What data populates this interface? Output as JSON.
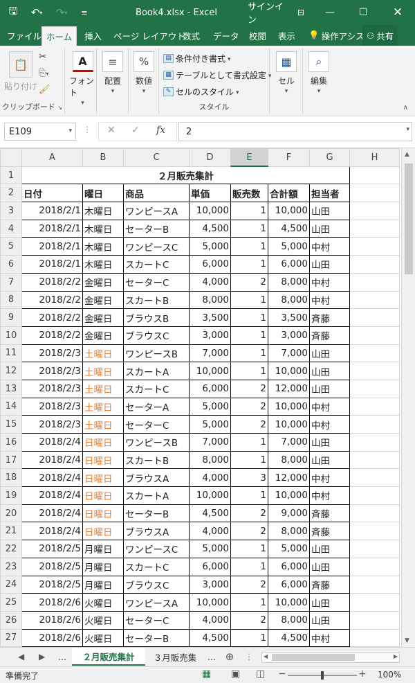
{
  "titlebar": {
    "title": "Book4.xlsx  -  Excel",
    "signin": "サインイン",
    "save_icon": "save-icon",
    "undo_icon": "undo-icon",
    "redo_icon": "redo-icon"
  },
  "tabs": [
    "ファイル",
    "ホーム",
    "挿入",
    "ページ レイアウト",
    "数式",
    "データ",
    "校閲",
    "表示"
  ],
  "tell_me": "操作アシス",
  "share": "共有",
  "ribbon": {
    "paste": "貼り付け",
    "clipboard": "クリップボード",
    "font": "フォント",
    "alignment": "配置",
    "number": "数値",
    "cond_format": "条件付き書式",
    "table_format": "テーブルとして書式設定",
    "cell_style": "セルのスタイル",
    "styles": "スタイル",
    "cells": "セル",
    "editing": "編集"
  },
  "formula_bar": {
    "name_box": "E109",
    "value": "2"
  },
  "columns": [
    "A",
    "B",
    "C",
    "D",
    "E",
    "F",
    "G",
    "H"
  ],
  "selected_column": "E",
  "sheet": {
    "title": "２月販売集計",
    "headers": [
      "日付",
      "曜日",
      "商品",
      "単価",
      "販売数",
      "合計額",
      "担当者"
    ],
    "rows": [
      {
        "n": "3",
        "date": "2018/2/1",
        "day": "木曜日",
        "item": "ワンピースA",
        "price": "10,000",
        "qty": "1",
        "total": "10,000",
        "rep": "山田",
        "wk": false
      },
      {
        "n": "4",
        "date": "2018/2/1",
        "day": "木曜日",
        "item": "セーターB",
        "price": "4,500",
        "qty": "1",
        "total": "4,500",
        "rep": "山田",
        "wk": false
      },
      {
        "n": "5",
        "date": "2018/2/1",
        "day": "木曜日",
        "item": "ワンピースC",
        "price": "5,000",
        "qty": "1",
        "total": "5,000",
        "rep": "中村",
        "wk": false
      },
      {
        "n": "6",
        "date": "2018/2/1",
        "day": "木曜日",
        "item": "スカートC",
        "price": "6,000",
        "qty": "1",
        "total": "6,000",
        "rep": "山田",
        "wk": false
      },
      {
        "n": "7",
        "date": "2018/2/2",
        "day": "金曜日",
        "item": "セーターC",
        "price": "4,000",
        "qty": "2",
        "total": "8,000",
        "rep": "中村",
        "wk": false
      },
      {
        "n": "8",
        "date": "2018/2/2",
        "day": "金曜日",
        "item": "スカートB",
        "price": "8,000",
        "qty": "1",
        "total": "8,000",
        "rep": "中村",
        "wk": false
      },
      {
        "n": "9",
        "date": "2018/2/2",
        "day": "金曜日",
        "item": "ブラウスB",
        "price": "3,500",
        "qty": "1",
        "total": "3,500",
        "rep": "斉藤",
        "wk": false
      },
      {
        "n": "10",
        "date": "2018/2/2",
        "day": "金曜日",
        "item": "ブラウスC",
        "price": "3,000",
        "qty": "1",
        "total": "3,000",
        "rep": "斉藤",
        "wk": false
      },
      {
        "n": "11",
        "date": "2018/2/3",
        "day": "土曜日",
        "item": "ワンピースB",
        "price": "7,000",
        "qty": "1",
        "total": "7,000",
        "rep": "山田",
        "wk": true
      },
      {
        "n": "12",
        "date": "2018/2/3",
        "day": "土曜日",
        "item": "スカートA",
        "price": "10,000",
        "qty": "1",
        "total": "10,000",
        "rep": "山田",
        "wk": true
      },
      {
        "n": "13",
        "date": "2018/2/3",
        "day": "土曜日",
        "item": "スカートC",
        "price": "6,000",
        "qty": "2",
        "total": "12,000",
        "rep": "山田",
        "wk": true
      },
      {
        "n": "14",
        "date": "2018/2/3",
        "day": "土曜日",
        "item": "セーターA",
        "price": "5,000",
        "qty": "2",
        "total": "10,000",
        "rep": "中村",
        "wk": true
      },
      {
        "n": "15",
        "date": "2018/2/3",
        "day": "土曜日",
        "item": "セーターC",
        "price": "5,000",
        "qty": "2",
        "total": "10,000",
        "rep": "中村",
        "wk": true
      },
      {
        "n": "16",
        "date": "2018/2/4",
        "day": "日曜日",
        "item": "ワンピースB",
        "price": "7,000",
        "qty": "1",
        "total": "7,000",
        "rep": "山田",
        "wk": true
      },
      {
        "n": "17",
        "date": "2018/2/4",
        "day": "日曜日",
        "item": "スカートB",
        "price": "8,000",
        "qty": "1",
        "total": "8,000",
        "rep": "山田",
        "wk": true
      },
      {
        "n": "18",
        "date": "2018/2/4",
        "day": "日曜日",
        "item": "ブラウスA",
        "price": "4,000",
        "qty": "3",
        "total": "12,000",
        "rep": "中村",
        "wk": true
      },
      {
        "n": "19",
        "date": "2018/2/4",
        "day": "日曜日",
        "item": "スカートA",
        "price": "10,000",
        "qty": "1",
        "total": "10,000",
        "rep": "中村",
        "wk": true
      },
      {
        "n": "20",
        "date": "2018/2/4",
        "day": "日曜日",
        "item": "セーターB",
        "price": "4,500",
        "qty": "2",
        "total": "9,000",
        "rep": "斉藤",
        "wk": true
      },
      {
        "n": "21",
        "date": "2018/2/4",
        "day": "日曜日",
        "item": "ブラウスA",
        "price": "4,000",
        "qty": "2",
        "total": "8,000",
        "rep": "斉藤",
        "wk": true
      },
      {
        "n": "22",
        "date": "2018/2/5",
        "day": "月曜日",
        "item": "ワンピースC",
        "price": "5,000",
        "qty": "1",
        "total": "5,000",
        "rep": "山田",
        "wk": false
      },
      {
        "n": "23",
        "date": "2018/2/5",
        "day": "月曜日",
        "item": "スカートC",
        "price": "6,000",
        "qty": "1",
        "total": "6,000",
        "rep": "山田",
        "wk": false
      },
      {
        "n": "24",
        "date": "2018/2/5",
        "day": "月曜日",
        "item": "ブラウスC",
        "price": "3,000",
        "qty": "2",
        "total": "6,000",
        "rep": "斉藤",
        "wk": false
      },
      {
        "n": "25",
        "date": "2018/2/6",
        "day": "火曜日",
        "item": "ワンピースA",
        "price": "10,000",
        "qty": "1",
        "total": "10,000",
        "rep": "山田",
        "wk": false
      },
      {
        "n": "26",
        "date": "2018/2/6",
        "day": "火曜日",
        "item": "セーターC",
        "price": "4,000",
        "qty": "2",
        "total": "8,000",
        "rep": "山田",
        "wk": false
      },
      {
        "n": "27",
        "date": "2018/2/6",
        "day": "火曜日",
        "item": "セーターB",
        "price": "4,500",
        "qty": "1",
        "total": "4,500",
        "rep": "中村",
        "wk": false
      }
    ]
  },
  "sheet_tabs": [
    "...",
    "２月販売集計",
    "３月販売集",
    "..."
  ],
  "status": {
    "ready": "準備完了",
    "zoom": "100%"
  },
  "colors": {
    "excel_green": "#217346",
    "weekend": "#ed7d31"
  }
}
